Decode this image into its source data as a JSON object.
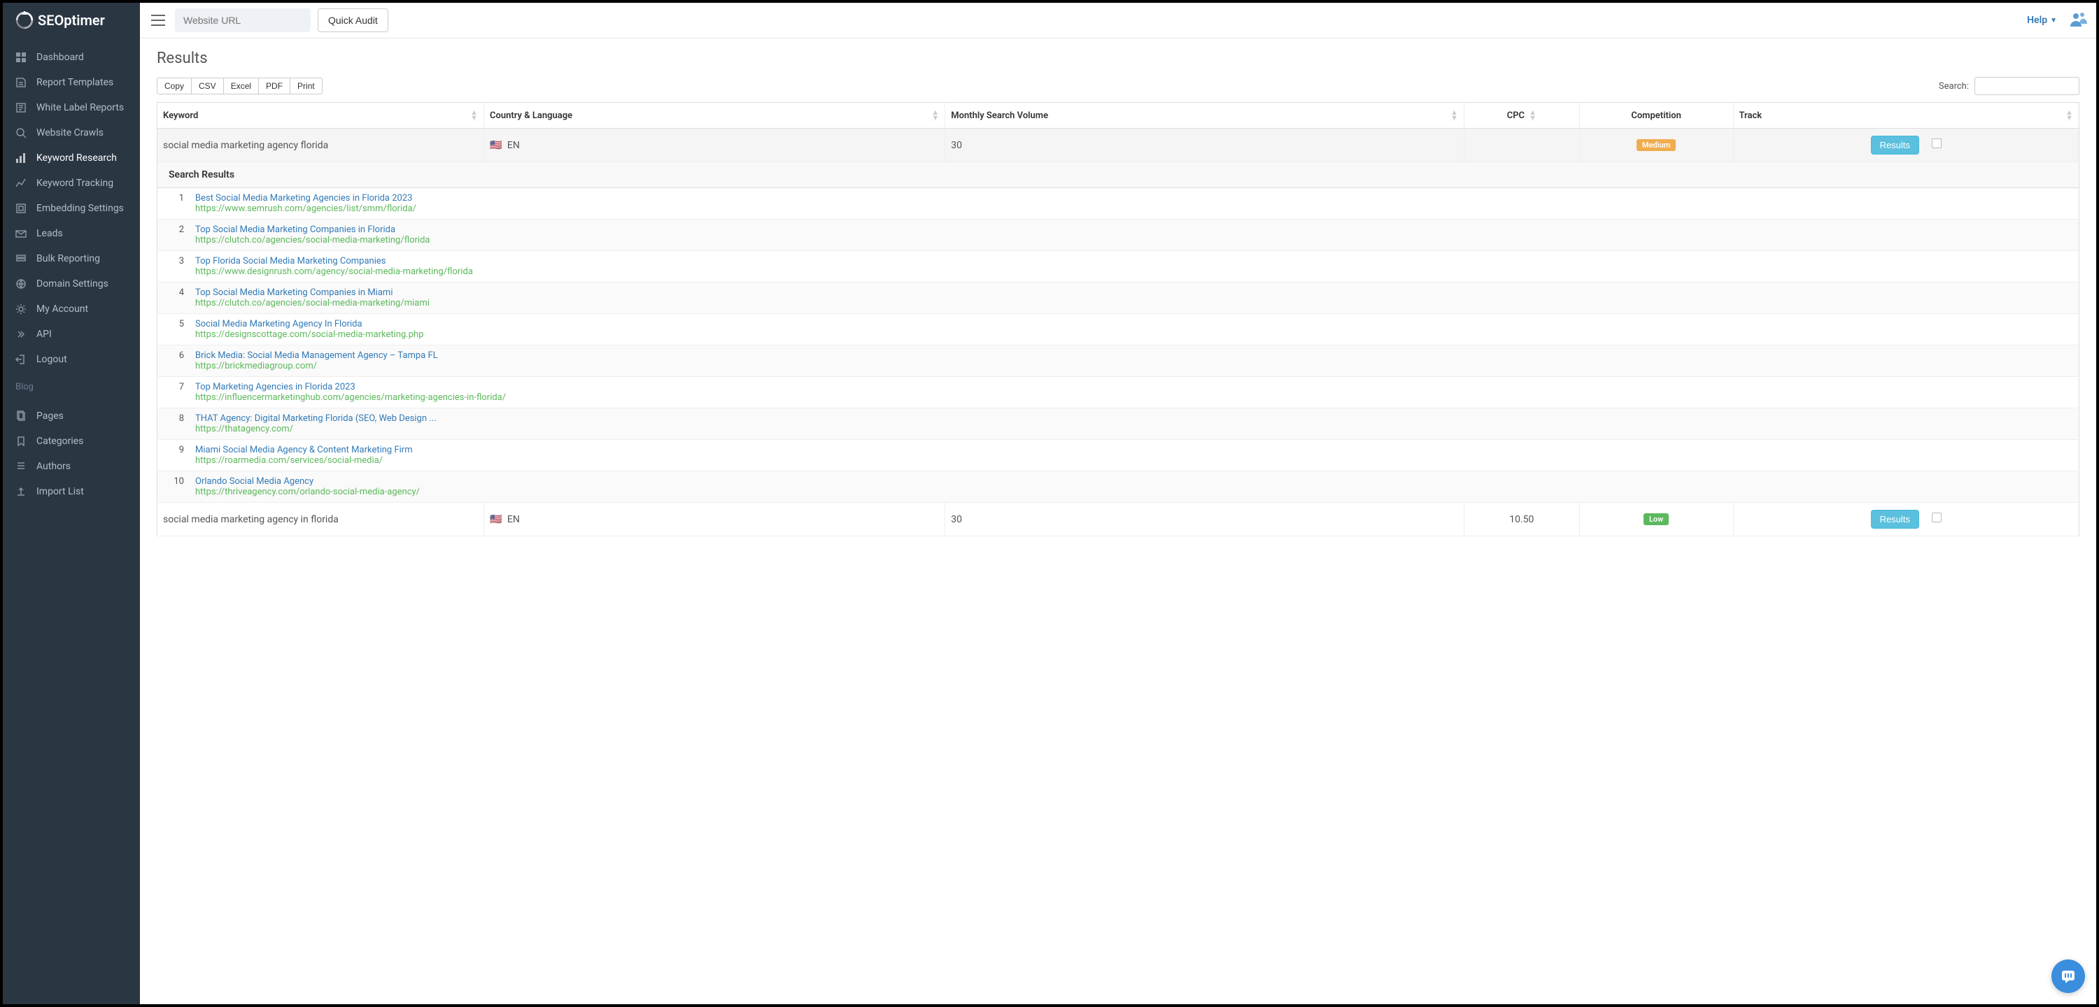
{
  "brand": "SEOptimer",
  "topbar": {
    "url_placeholder": "Website URL",
    "quick_audit_label": "Quick Audit",
    "help_label": "Help"
  },
  "sidebar": {
    "items": [
      {
        "label": "Dashboard"
      },
      {
        "label": "Report Templates"
      },
      {
        "label": "White Label Reports"
      },
      {
        "label": "Website Crawls"
      },
      {
        "label": "Keyword Research",
        "active": true
      },
      {
        "label": "Keyword Tracking"
      },
      {
        "label": "Embedding Settings"
      },
      {
        "label": "Leads"
      },
      {
        "label": "Bulk Reporting"
      },
      {
        "label": "Domain Settings"
      },
      {
        "label": "My Account"
      },
      {
        "label": "API"
      },
      {
        "label": "Logout"
      }
    ],
    "blog_label": "Blog",
    "blog_items": [
      {
        "label": "Pages"
      },
      {
        "label": "Categories"
      },
      {
        "label": "Authors"
      },
      {
        "label": "Import List"
      }
    ]
  },
  "page": {
    "title": "Results",
    "export_buttons": [
      "Copy",
      "CSV",
      "Excel",
      "PDF",
      "Print"
    ],
    "search_label": "Search:"
  },
  "columns": {
    "keyword": "Keyword",
    "country": "Country & Language",
    "volume": "Monthly Search Volume",
    "cpc": "CPC",
    "competition": "Competition",
    "track": "Track"
  },
  "rows": [
    {
      "keyword": "social media marketing agency florida",
      "country_flag": "🇺🇸",
      "language": "EN",
      "volume": "30",
      "cpc": "",
      "competition": "Medium",
      "competition_class": "badge-medium",
      "results_label": "Results"
    },
    {
      "keyword": "social media marketing agency in florida",
      "country_flag": "🇺🇸",
      "language": "EN",
      "volume": "30",
      "cpc": "10.50",
      "competition": "Low",
      "competition_class": "badge-low",
      "results_label": "Results"
    }
  ],
  "search_results_header": "Search Results",
  "search_results": [
    {
      "idx": "1",
      "title": "Best Social Media Marketing Agencies in Florida 2023",
      "url": "https://www.semrush.com/agencies/list/smm/florida/"
    },
    {
      "idx": "2",
      "title": "Top Social Media Marketing Companies in Florida",
      "url": "https://clutch.co/agencies/social-media-marketing/florida"
    },
    {
      "idx": "3",
      "title": "Top Florida Social Media Marketing Companies",
      "url": "https://www.designrush.com/agency/social-media-marketing/florida"
    },
    {
      "idx": "4",
      "title": "Top Social Media Marketing Companies in Miami",
      "url": "https://clutch.co/agencies/social-media-marketing/miami"
    },
    {
      "idx": "5",
      "title": "Social Media Marketing Agency In Florida",
      "url": "https://designscottage.com/social-media-marketing.php"
    },
    {
      "idx": "6",
      "title": "Brick Media: Social Media Management Agency – Tampa FL",
      "url": "https://brickmediagroup.com/"
    },
    {
      "idx": "7",
      "title": "Top Marketing Agencies in Florida 2023",
      "url": "https://influencermarketinghub.com/agencies/marketing-agencies-in-florida/"
    },
    {
      "idx": "8",
      "title": "THAT Agency: Digital Marketing Florida (SEO, Web Design ...",
      "url": "https://thatagency.com/"
    },
    {
      "idx": "9",
      "title": "Miami Social Media Agency & Content Marketing Firm",
      "url": "https://roarmedia.com/services/social-media/"
    },
    {
      "idx": "10",
      "title": "Orlando Social Media Agency",
      "url": "https://thriveagency.com/orlando-social-media-agency/"
    }
  ]
}
